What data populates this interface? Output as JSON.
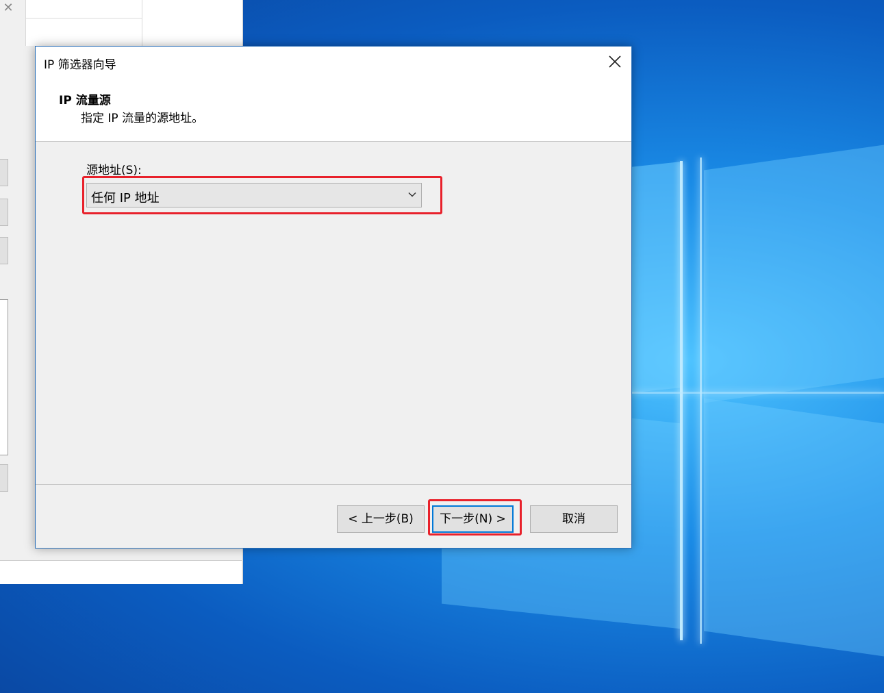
{
  "dialog": {
    "title": "IP 筛选器向导",
    "header_title": "IP 流量源",
    "header_subtitle": "指定 IP 流量的源地址。",
    "source_label": "源地址(S):",
    "source_value": "任何 IP 地址",
    "buttons": {
      "back": "< 上一步(B)",
      "next": "下一步(N) >",
      "cancel": "取消"
    }
  },
  "colors": {
    "highlight": "#e8212b",
    "focus": "#0078d7"
  }
}
